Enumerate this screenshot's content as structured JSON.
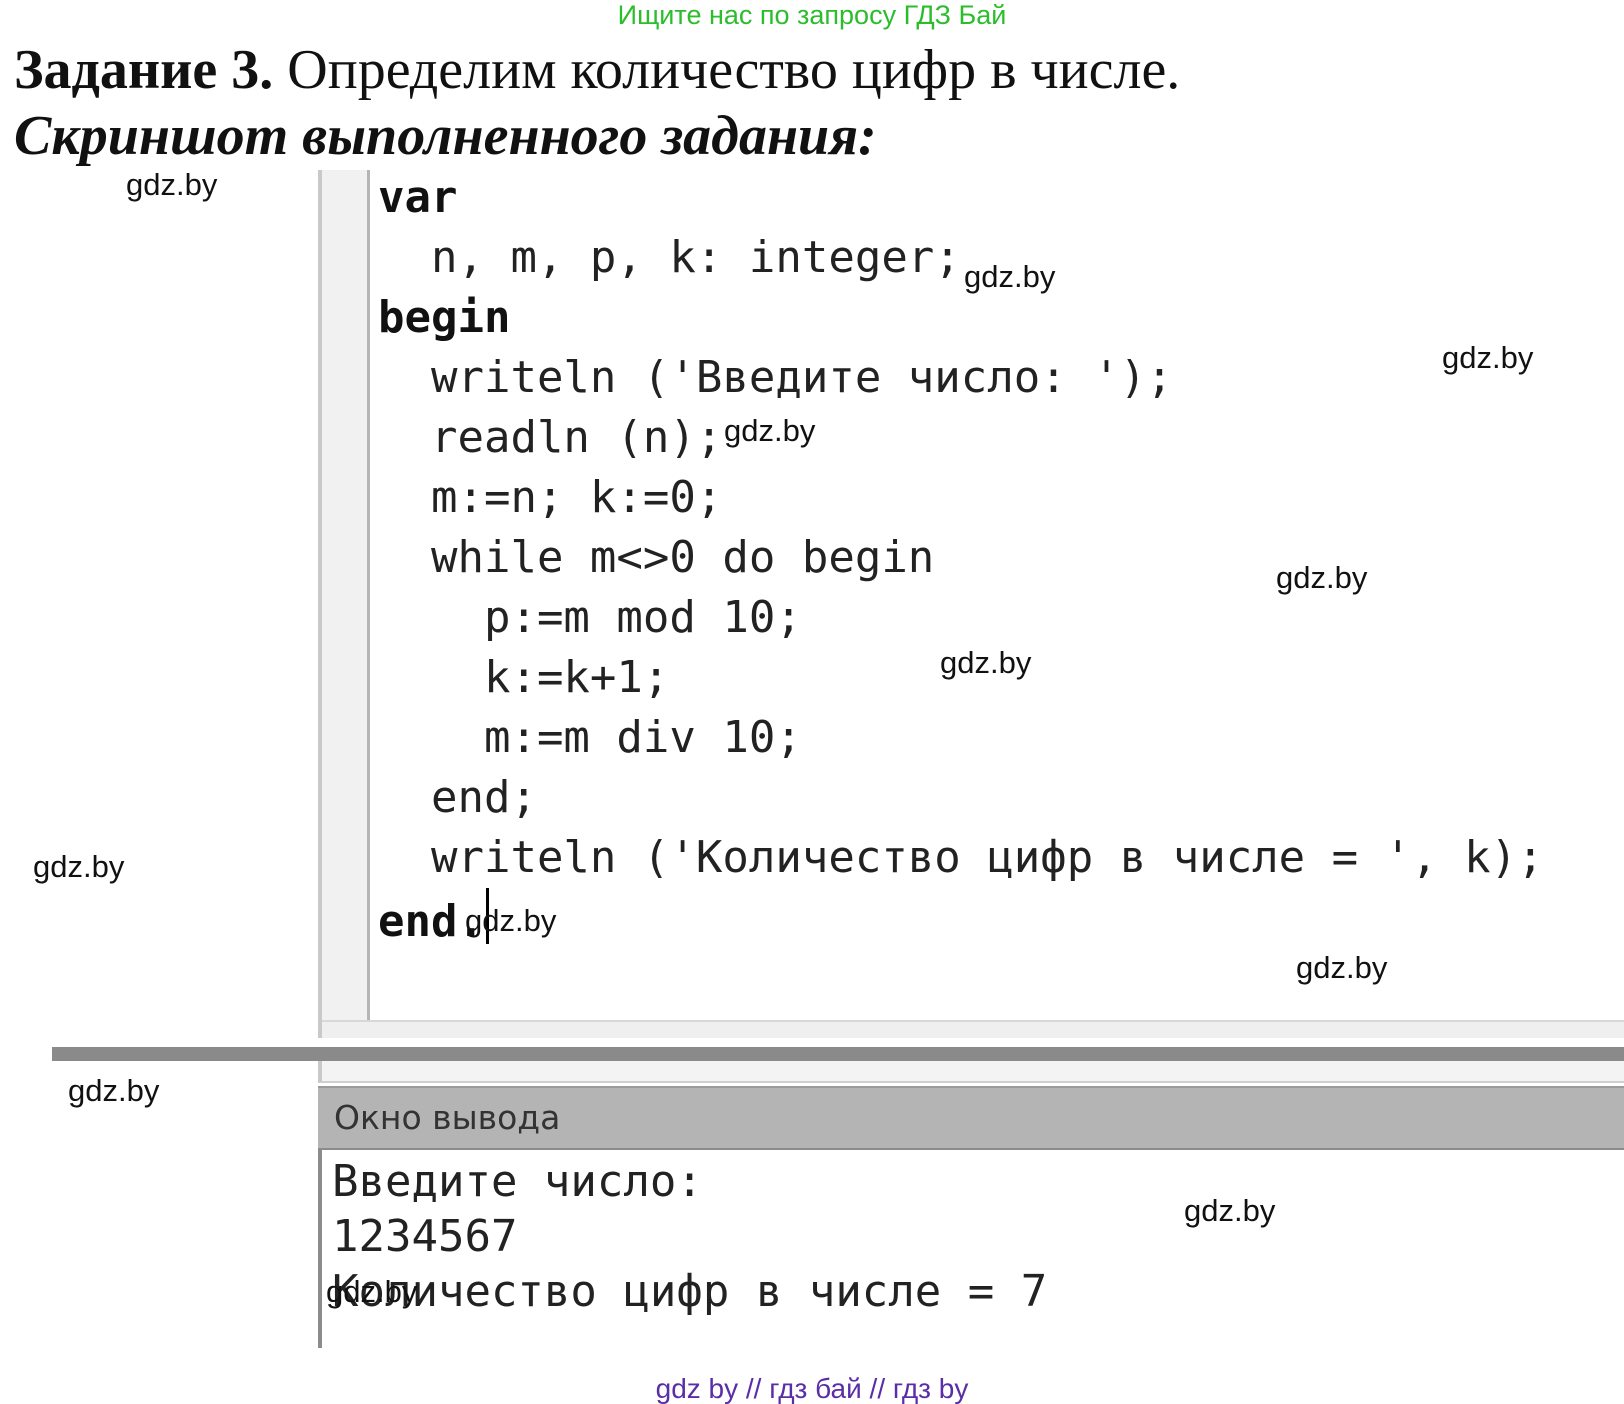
{
  "top_banner": "Ищите нас по запросу ГДЗ Бай",
  "task": {
    "label": "Задание 3.",
    "text": "Определим количество цифр в числе."
  },
  "caption": "Скриншот выполненного задания:",
  "editor": {
    "code_lines": [
      "var",
      "  n, m, p, k: integer;",
      "begin",
      "  writeln ('Введите число: ');",
      "  readln (n);",
      "  m:=n; k:=0;",
      "  while m<>0 do begin",
      "    p:=m mod 10;",
      "    k:=k+1;",
      "    m:=m div 10;",
      "  end;",
      "  writeln ('Количество цифр в числе = ', k);",
      "end."
    ]
  },
  "output": {
    "title": "Окно вывода",
    "lines": [
      "Введите число:",
      "1234567",
      "Количество цифр в числе = 7"
    ]
  },
  "watermark_text": "gdz.by",
  "footer": "gdz by  //  гдз бай  //  гдз by"
}
